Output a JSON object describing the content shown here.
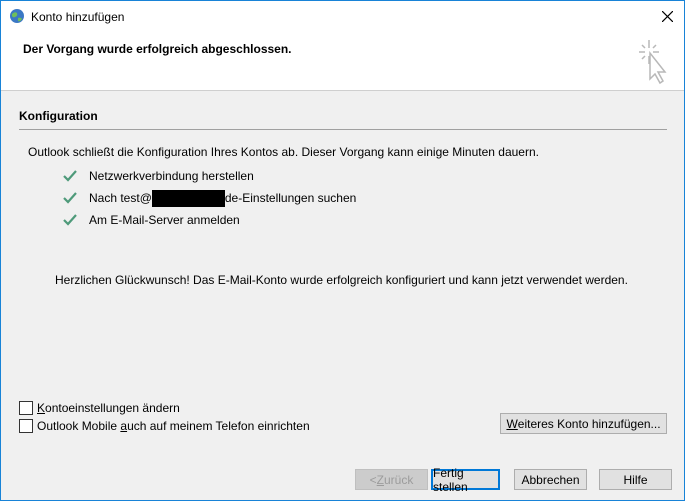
{
  "window": {
    "title": "Konto hinzufügen"
  },
  "header": {
    "text": "Der Vorgang wurde erfolgreich abgeschlossen."
  },
  "config": {
    "section_title": "Konfiguration",
    "intro": "Outlook schließt die Konfiguration Ihres Kontos ab. Dieser Vorgang kann einige Minuten dauern.",
    "steps": [
      {
        "text": "Netzwerkverbindung herstellen"
      },
      {
        "prefix": "Nach test@",
        "suffix": "de-Einstellungen suchen"
      },
      {
        "text": "Am E-Mail-Server anmelden"
      }
    ],
    "congrats": "Herzlichen Glückwunsch! Das E-Mail-Konto wurde erfolgreich konfiguriert und kann jetzt verwendet werden."
  },
  "options": {
    "change_settings": {
      "underlined": "K",
      "rest": "ontoeinstellungen ändern"
    },
    "outlook_mobile": {
      "before": "Outlook Mobile ",
      "underlined": "a",
      "after": "uch auf meinem Telefon einrichten"
    }
  },
  "buttons": {
    "add_account": {
      "underlined": "W",
      "rest": "eiteres Konto hinzufügen..."
    },
    "back": {
      "prefix": "< ",
      "underlined": "Z",
      "rest": "urück"
    },
    "finish": "Fertig stellen",
    "cancel": "Abbrechen",
    "help": "Hilfe"
  },
  "colors": {
    "check": "#4e9a7a",
    "accent": "#0078d7"
  }
}
